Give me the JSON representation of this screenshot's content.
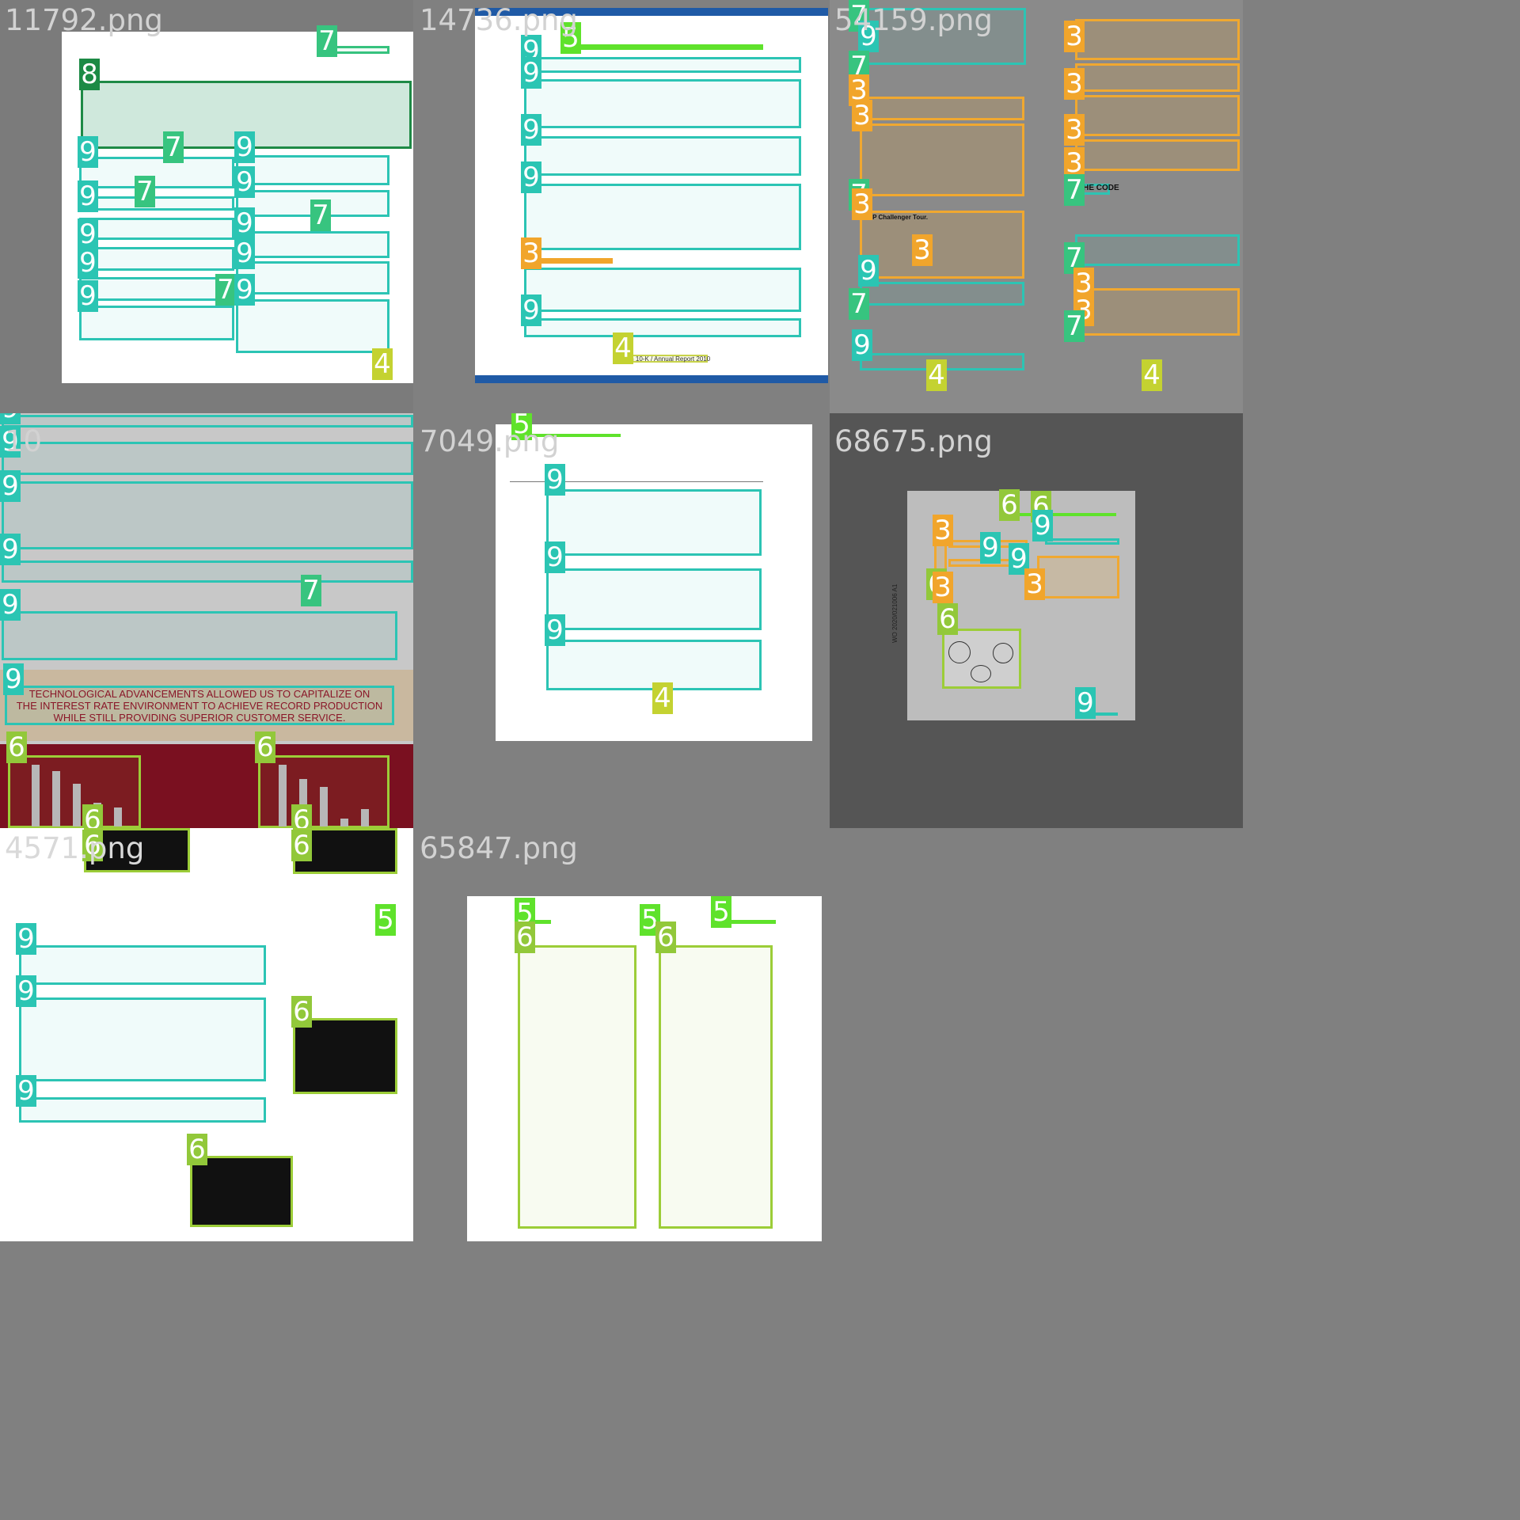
{
  "tiles": [
    {
      "filename": "11792.png"
    },
    {
      "filename": "14736.png"
    },
    {
      "filename": "54159.png"
    },
    {
      "filename": "10"
    },
    {
      "filename": "7049.png"
    },
    {
      "filename": "68675.png"
    },
    {
      "filename": "4571.png"
    },
    {
      "filename": "65847.png"
    }
  ],
  "labels": {
    "text": "9",
    "title": "7",
    "table": "8",
    "footer": "4",
    "header": "5",
    "figure": "6",
    "section": "3"
  },
  "snippets": {
    "t14736_footer": "Form 10-K / Annual Report 2010",
    "t10_banner_line1": "TECHNOLOGICAL ADVANCEMENTS ALLOWED US TO CAPITALIZE ON",
    "t10_banner_line2": "THE INTEREST RATE ENVIRONMENT TO ACHIEVE RECORD PRODUCTION",
    "t10_banner_line3": "WHILE STILL PROVIDING SUPERIOR CUSTOMER SERVICE.",
    "t54159_code": "THE CODE",
    "t54159_challenger": "ATP Challenger Tour.",
    "t68675_wo": "WO 2020/021006 A1"
  },
  "colors": {
    "text_box": "#2bc5b3",
    "title_box": "#37c47f",
    "table_box": "#1c8a45",
    "footer_box": "#c4d231",
    "header_box": "#5fe22b",
    "figure_box": "#92c83a",
    "section_box": "#f1a52b"
  }
}
